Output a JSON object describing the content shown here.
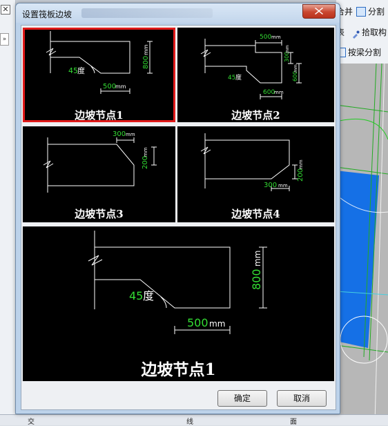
{
  "dialog": {
    "title": "设置筏板边坡",
    "ok_label": "确定",
    "cancel_label": "取消"
  },
  "thumbnails": [
    {
      "caption": "边坡节点1",
      "labels": {
        "angle_value": "45",
        "angle_unit": "度",
        "width_value": "500",
        "width_unit": "mm",
        "height_value": "800",
        "height_unit": "mm"
      }
    },
    {
      "caption": "边坡节点2",
      "labels": {
        "top_value": "500",
        "top_unit": "mm",
        "right_value": "300",
        "right_unit": "mm",
        "height_value": "600",
        "height_unit": "mm",
        "angle_value": "45",
        "angle_unit": "度",
        "bottom_value": "600",
        "bottom_unit": "mm"
      }
    },
    {
      "caption": "边坡节点3",
      "labels": {
        "width_value": "300",
        "width_unit": "mm",
        "height_value": "200",
        "height_unit": "mm"
      }
    },
    {
      "caption": "边坡节点4",
      "labels": {
        "width_value": "300",
        "width_unit": "mm",
        "height_value": "200",
        "height_unit": "mm"
      }
    }
  ],
  "preview": {
    "caption": "边坡节点1",
    "angle_value": "45",
    "angle_unit": "度",
    "width_value": "500",
    "width_unit": "mm",
    "height_value": "800",
    "height_unit": "mm"
  },
  "background": {
    "toolbar": [
      "合并",
      "分割",
      "表",
      "拾取构",
      "按梁分割"
    ],
    "bottom_bar": [
      "交",
      "线",
      "面"
    ],
    "colors": {
      "canvas": "#b7b7b7",
      "blue_region": "#1570e6",
      "green_line": "#22aa22"
    }
  }
}
